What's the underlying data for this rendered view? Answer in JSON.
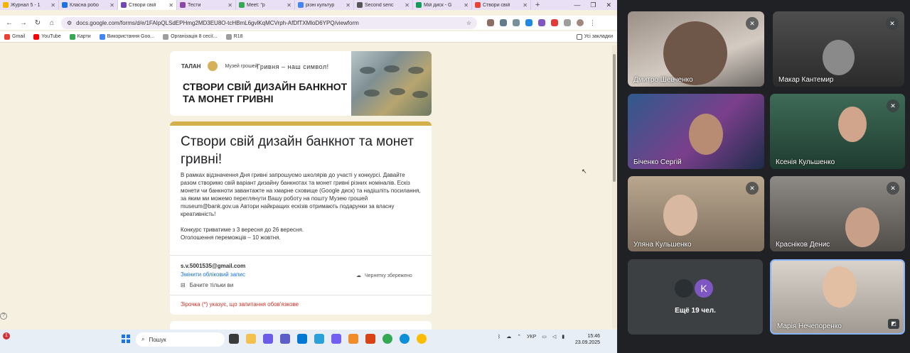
{
  "browser": {
    "tabs": [
      {
        "label": "Журнал 5 - 1",
        "color": "#f4b400",
        "active": false
      },
      {
        "label": "Класна робо",
        "color": "#1a73e8",
        "active": false
      },
      {
        "label": "Створи свій",
        "color": "#7248b9",
        "active": true
      },
      {
        "label": "Тести",
        "color": "#8e44ad",
        "active": false
      },
      {
        "label": "Meet: \"р",
        "color": "#34a853",
        "active": false
      },
      {
        "label": "різні культур",
        "color": "#4285f4",
        "active": false
      },
      {
        "label": "Second seric",
        "color": "#555555",
        "active": false
      },
      {
        "label": "Мій диск - G",
        "color": "#0f9d58",
        "active": false
      },
      {
        "label": "Створи свій",
        "color": "#ea4335",
        "active": false
      }
    ],
    "new_tab": "+",
    "url": "docs.google.com/forms/d/e/1FAIpQLSdEPHmg2MD3EU8O-tcHBmL6gvlKqMCVrph-AfDfTXMloD6YPQ/viewform",
    "bookmarks": [
      {
        "label": "Gmail",
        "color": "#ea4335"
      },
      {
        "label": "YouTube",
        "color": "#ff0000"
      },
      {
        "label": "Карти",
        "color": "#34a853"
      },
      {
        "label": "Використання Goo...",
        "color": "#4285f4"
      },
      {
        "label": "Організація 8 сесії...",
        "color": "#9e9e9e"
      },
      {
        "label": "R18",
        "color": "#9e9e9e"
      }
    ],
    "all_bookmarks": "Усі закладки"
  },
  "form": {
    "banner": {
      "logo_left": "ТАЛАН",
      "logo_right": "Музей грошей",
      "slogan": "Гривня – наш символ!",
      "headline": "СТВОРИ СВІЙ ДИЗАЙН БАНКНОТ ТА МОНЕТ ГРИВНІ"
    },
    "title": "Створи свій дизайн банкнот та монет гривні!",
    "description_1": "В рамках відзначення Дня гривні запрошуємо школярів до участі у конкурсі. Давайте разом створимо свій варіант дизайну банкнотах та монет гривні різних номіналів. Ескіз монети чи банкноти завантажте на хмарне сховище (Google диск) та надішліть посилання, за яким ми можемо переглянути Вашу роботу на пошту Музею грошей museum@bank.gov.ua  Автори найкращих ескізів отримають подарунки за власну креативність!",
    "description_2": "Конкурс триватиме з 3 вересня до 26 вересня.",
    "description_3": "Оголошення переможців – 10 жовтня.",
    "email": "s.v.5001535@gmail.com",
    "switch_account": "Змінити обліковий запис",
    "draft_saved": "Чернетку збережено",
    "visible_only": "Бачите тільки ви",
    "required_note": "Зірочка (*) указує, що запитання обов'язкове"
  },
  "taskbar": {
    "search_placeholder": "Пошук",
    "notification_count": "1",
    "language": "УКР",
    "time": "15:46",
    "date": "23.09.2025"
  },
  "meet": {
    "participants": [
      {
        "name": "Дмитро Шевченко",
        "muted": true
      },
      {
        "name": "Макар Кантемир",
        "muted": true
      },
      {
        "name": "Бiченко Сергій",
        "muted": false
      },
      {
        "name": "Ксенія Кульшенко",
        "muted": true
      },
      {
        "name": "Уляна Кульшенко",
        "muted": true
      },
      {
        "name": "Красніков Денис",
        "muted": true
      },
      {
        "name": "Марія Нечепоренко",
        "muted": false
      }
    ],
    "others_count": "Ещё 19 чел.",
    "others_avatar_letter": "K"
  }
}
